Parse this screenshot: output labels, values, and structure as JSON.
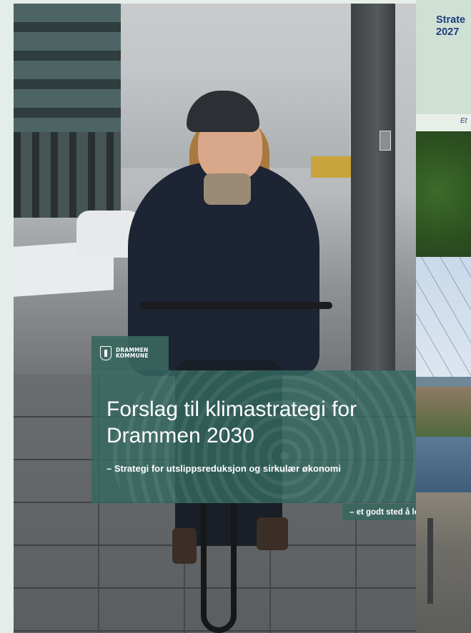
{
  "main_cover": {
    "logo": {
      "line1": "DRAMMEN",
      "line2": "KOMMUNE"
    },
    "title_line1": "Forslag til klimastrategi for",
    "title_line2": "Drammen 2030",
    "subtitle": "– Strategi for utslippsreduksjon og sirkulær økonomi",
    "tagline": "– et godt sted å leve",
    "colors": {
      "panel": "#346960",
      "text": "#ffffff"
    }
  },
  "second_cover": {
    "title_line1": "Strate",
    "title_line2": "2027",
    "band_text": "Et",
    "colors": {
      "title": "#1e3c7a",
      "top_background": "#cfe0d5"
    }
  }
}
